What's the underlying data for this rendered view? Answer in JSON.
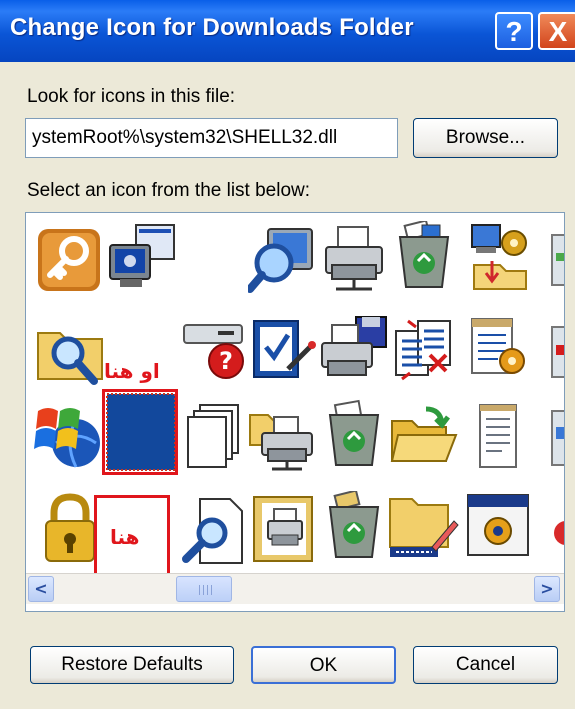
{
  "window": {
    "title": "Change Icon for Downloads Folder",
    "help_glyph": "?",
    "close_glyph": "X"
  },
  "file_section": {
    "label": "Look for icons in this file:",
    "path_value": "ystemRoot%\\system32\\SHELL32.dll",
    "browse_label": "Browse..."
  },
  "icon_list": {
    "label": "Select an icon from the list below:",
    "icons": [
      "key-icon",
      "display-properties-icon",
      "",
      "search-computer-icon",
      "printer-icon",
      "recycle-bin-full-icon",
      "network-settings-icon",
      "search-folder-icon",
      "",
      "help-drive-icon",
      "task-check-icon",
      "printer-disk-icon",
      "copy-document-icon",
      "notepad-settings-icon",
      "windows-globe-icon",
      "blank-blue-icon",
      "stacked-pages-icon",
      "network-printer-icon",
      "recycle-bin-icon",
      "open-folder-icon",
      "document-icon",
      "lock-icon",
      "",
      "search-document-icon",
      "printer-frame-icon",
      "recycle-bin-closed-icon",
      "folder-pencil-icon",
      "window-gear-icon"
    ],
    "selected": "blank-blue-icon"
  },
  "annotations": {
    "upper": "او هنا",
    "lower": "هنا",
    "color": "#e0161c"
  },
  "scrollbar": {
    "left_glyph": "<",
    "right_glyph": ">"
  },
  "buttons": {
    "restore": "Restore Defaults",
    "ok": "OK",
    "cancel": "Cancel"
  },
  "colors": {
    "titlebar": "#0a55d6",
    "dialog_bg": "#ece9d8",
    "selection": "#12489c"
  }
}
